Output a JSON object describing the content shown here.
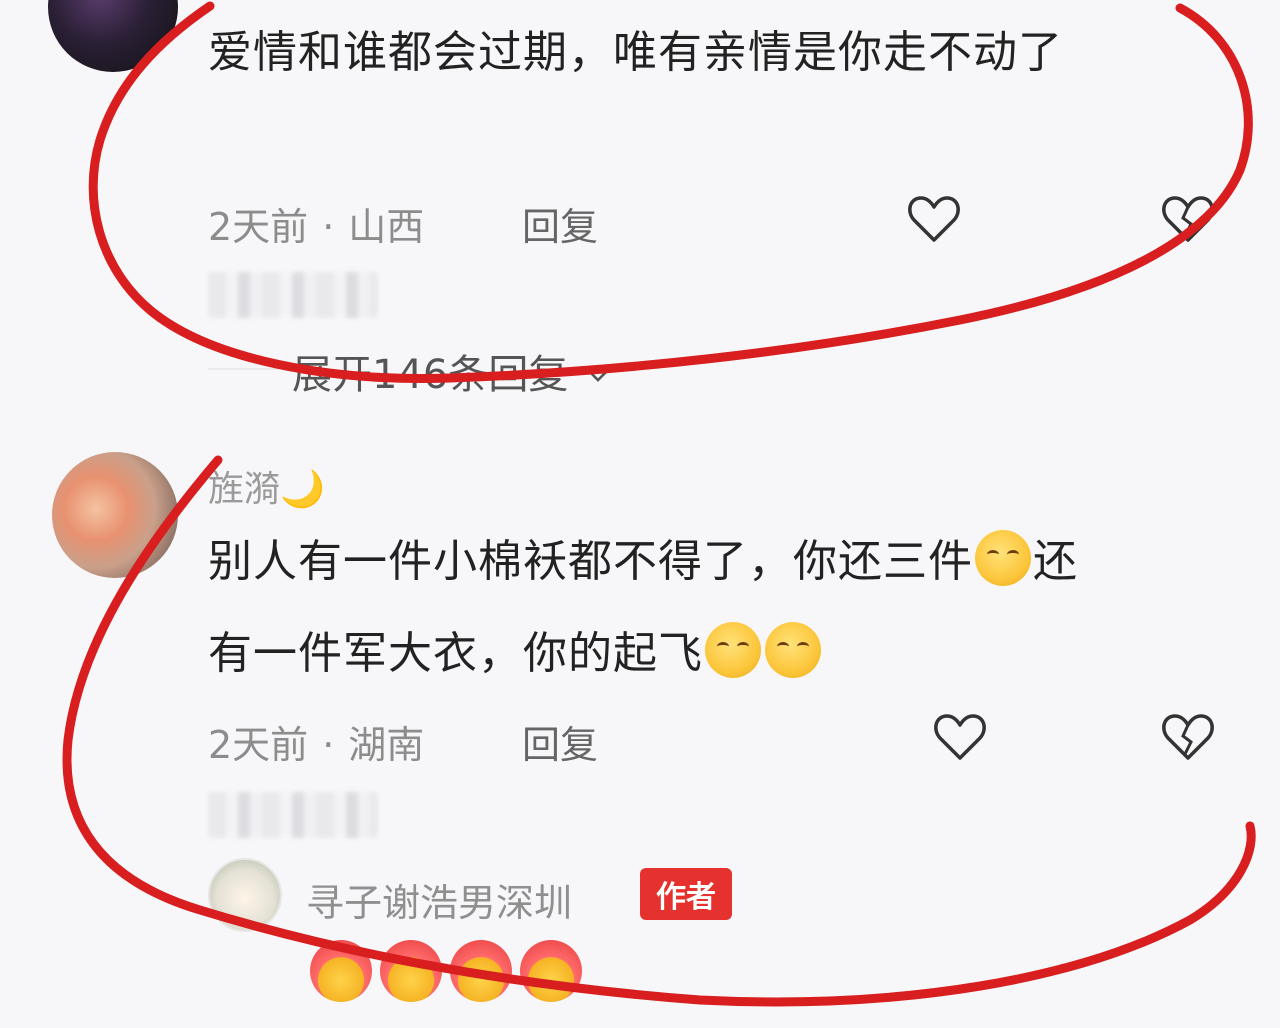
{
  "comments": [
    {
      "text": "爱情和谁都会过期，唯有亲情是你走不动了",
      "time": "2天前",
      "separator": "·",
      "location": "山西",
      "reply_label": "回复",
      "expand_label": "展开146条回复"
    },
    {
      "username": "旌漪🌙",
      "text_line1": "别人有一件小棉袄都不得了，你还三件",
      "text_line1_end": "还",
      "text_line2": "有一件军大衣，你的起飞",
      "time": "2天前",
      "separator": "·",
      "location": "湖南",
      "reply_label": "回复"
    }
  ],
  "author_reply": {
    "username": "寻子谢浩男深圳",
    "badge": "作者"
  },
  "colors": {
    "annotation_red": "#d81e1e",
    "badge_red": "#e6322f"
  },
  "icons": {
    "like": "heart-outline-icon",
    "dislike": "broken-heart-icon",
    "chevron": "chevron-down-icon",
    "emoji": "covering-mouth-laugh-emoji",
    "reaction": "heart-hands-emoji"
  }
}
